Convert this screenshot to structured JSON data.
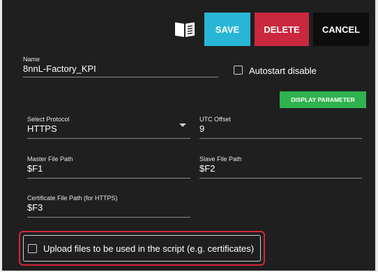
{
  "toolbar": {
    "manual_icon": "book-icon",
    "save_label": "SAVE",
    "delete_label": "DELETE",
    "cancel_label": "CANCEL",
    "colors": {
      "save": "#29b6d6",
      "delete": "#c9283e",
      "cancel": "#0d0d0d"
    }
  },
  "form": {
    "name": {
      "label": "Name",
      "value": "8nnL-Factory_KPI"
    },
    "autostart": {
      "label": "Autostart disable",
      "checked": false
    },
    "display_parameter_label": "DISPLAY PARAMETER",
    "protocol": {
      "label": "Select Protocol",
      "value": "HTTPS"
    },
    "utc_offset": {
      "label": "UTC Offset",
      "value": "9"
    },
    "master_path": {
      "label": "Master File Path",
      "value": "$F1"
    },
    "slave_path": {
      "label": "Slave File Path",
      "value": "$F2"
    },
    "cert_path": {
      "label": "Certificate File Path (for HTTPS)",
      "value": "$F3"
    },
    "upload": {
      "label": "Upload files to be used in the script (e.g. certificates)",
      "checked": false
    }
  }
}
